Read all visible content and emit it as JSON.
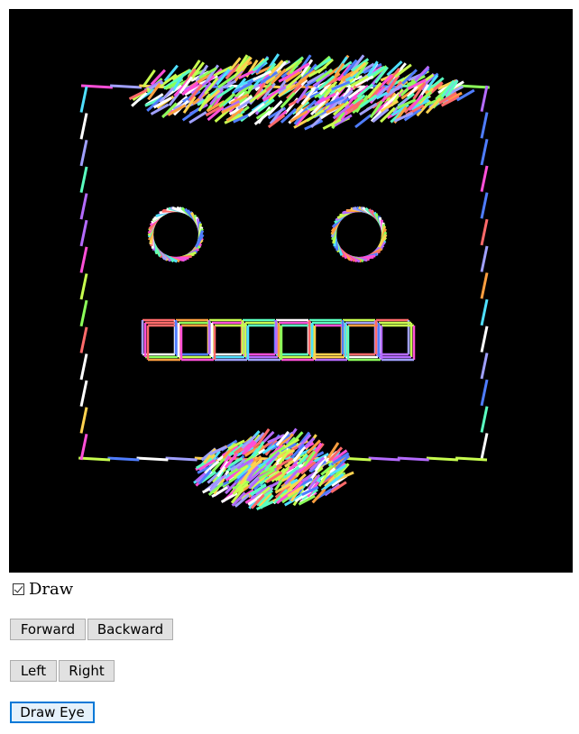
{
  "canvas": {
    "background": "#000000",
    "stroke_palette": [
      "#ff4fd8",
      "#4fe0ff",
      "#8cff5a",
      "#ffd24f",
      "#b56bff",
      "#ff6a6a",
      "#ffffff",
      "#5affc0",
      "#4f7dff",
      "#ff9f40",
      "#c8ff4f",
      "#a0a0ff"
    ]
  },
  "controls": {
    "draw_checkbox": {
      "label": "Draw",
      "checked": true
    },
    "forward_label": "Forward",
    "backward_label": "Backward",
    "left_label": "Left",
    "right_label": "Right",
    "draw_eye_label": "Draw Eye"
  }
}
